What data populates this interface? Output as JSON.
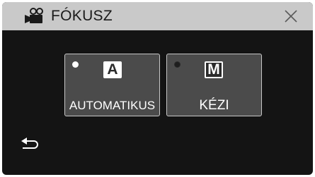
{
  "header": {
    "title": "FÓKUSZ",
    "icon": "video-camera-icon",
    "close_icon": "close-icon"
  },
  "modes": [
    {
      "glyph": "A",
      "label": "AUTOMATIKUS",
      "selected": true
    },
    {
      "glyph": "M",
      "label": "KÉZI",
      "selected": false
    }
  ],
  "footer": {
    "back_icon": "back-arrow-icon"
  },
  "colors": {
    "screen_bg": "#141414",
    "header_bg": "#c9c9c9",
    "button_bg": "#4b4b4b",
    "button_border": "#c7c7c7"
  }
}
